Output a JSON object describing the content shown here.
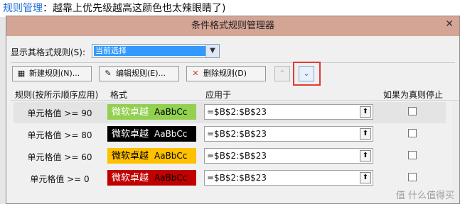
{
  "banner": {
    "label": "规则管理",
    "rest": "：越靠上优先级越高这颜色也太辣眼睛了)"
  },
  "dialog": {
    "title": "条件格式规则管理器",
    "close": "✕"
  },
  "filter": {
    "label": "显示其格式规则(S):",
    "selected": "当前选择"
  },
  "toolbar": {
    "new_rule": "新建规则(N)...",
    "edit_rule": "编辑规则(E)...",
    "delete_rule": "删除规则(D)",
    "move_up": "⌃",
    "move_down": "⌄"
  },
  "columns": {
    "rule": "规则(按所示顺序应用)",
    "format": "格式",
    "applies_to": "应用于",
    "stop_if_true": "如果为真则停止"
  },
  "rules": [
    {
      "condition": "单元格值 >= 90",
      "preview_cn": "微软卓越",
      "preview_en": "AaBbCc",
      "bg": "#92d050",
      "fg": "#000000",
      "cn_fg": "#ffffff",
      "applies": "=$B$2:$B$23"
    },
    {
      "condition": "单元格值 >= 80",
      "preview_cn": "微软卓越",
      "preview_en": "AaBbCc",
      "bg": "#000000",
      "fg": "#ffffff",
      "cn_fg": "#ffffff",
      "applies": "=$B$2:$B$23"
    },
    {
      "condition": "单元格值 >= 60",
      "preview_cn": "微软卓越",
      "preview_en": "AaBbCc",
      "bg": "#ffc000",
      "fg": "#000000",
      "cn_fg": "#000000",
      "applies": "=$B$2:$B$23"
    },
    {
      "condition": "单元格值 >= 0",
      "preview_cn": "微软卓越",
      "preview_en": "AaBbCc",
      "bg": "#c00000",
      "fg": "#000000",
      "cn_fg": "#ffffff",
      "applies": "=$B$2:$B$23"
    }
  ],
  "watermark": "值 什么值得买",
  "colors": {
    "accent_highlight": "#e03a3a",
    "selection": "#3399ff"
  }
}
